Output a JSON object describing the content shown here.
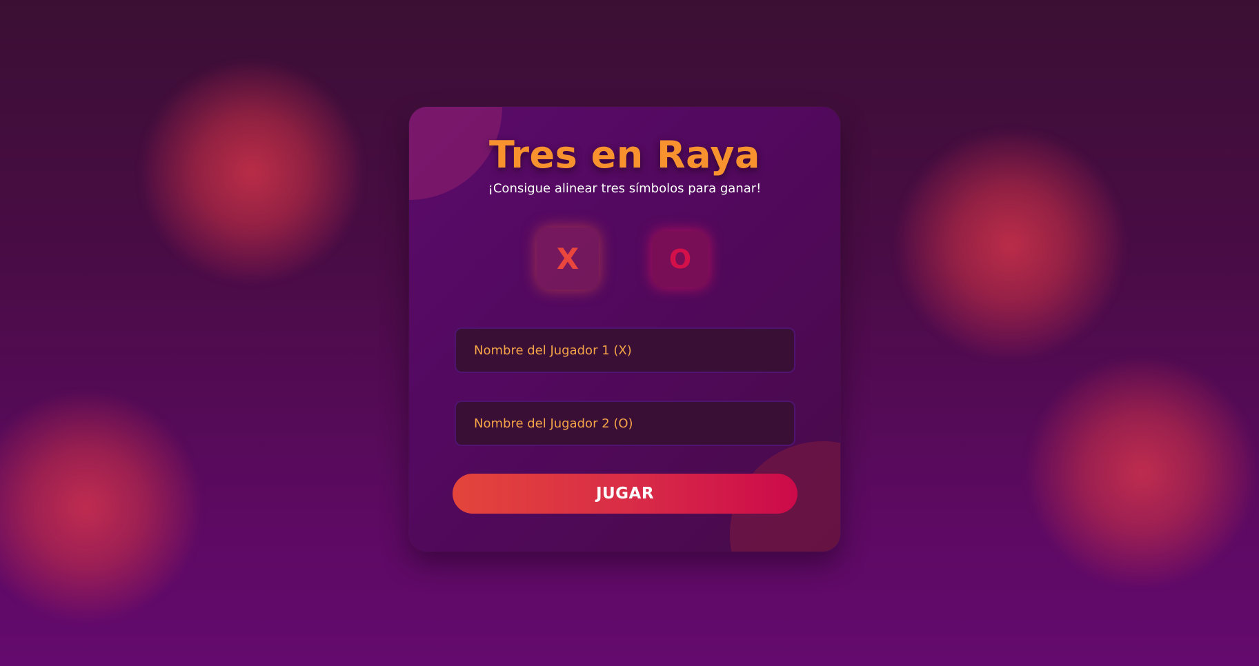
{
  "game": {
    "title": "Tres en Raya",
    "subtitle": "¡Consigue alinear tres símbolos para ganar!"
  },
  "symbols": {
    "player1": "X",
    "player2": "O"
  },
  "form": {
    "player1_placeholder": "Nombre del Jugador 1 (X)",
    "player2_placeholder": "Nombre del Jugador 2 (O)",
    "play_label": "JUGAR"
  },
  "colors": {
    "title": "#f7922e",
    "x_symbol": "#e9473d",
    "o_symbol": "#d4104a",
    "button_start": "#e3453b",
    "button_end": "#cc0a4a"
  }
}
